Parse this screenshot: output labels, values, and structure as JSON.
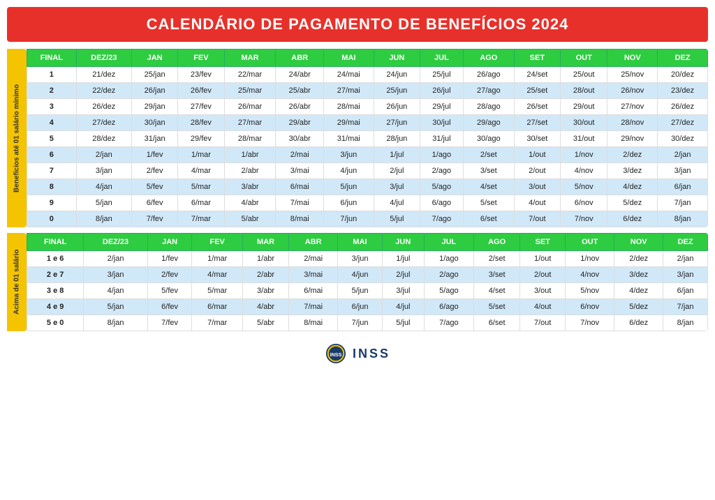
{
  "title": "CALENDÁRIO DE PAGAMENTO DE BENEFÍCIOS 2024",
  "table1": {
    "sideLabel": "Benefícios até 01 salário mínimo",
    "headers": [
      "FINAL",
      "DEZ/23",
      "JAN",
      "FEV",
      "MAR",
      "ABR",
      "MAI",
      "JUN",
      "JUL",
      "AGO",
      "SET",
      "OUT",
      "NOV",
      "DEZ"
    ],
    "rows": [
      [
        "1",
        "21/dez",
        "25/jan",
        "23/fev",
        "22/mar",
        "24/abr",
        "24/mai",
        "24/jun",
        "25/jul",
        "26/ago",
        "24/set",
        "25/out",
        "25/nov",
        "20/dez"
      ],
      [
        "2",
        "22/dez",
        "26/jan",
        "26/fev",
        "25/mar",
        "25/abr",
        "27/mai",
        "25/jun",
        "26/jul",
        "27/ago",
        "25/set",
        "28/out",
        "26/nov",
        "23/dez"
      ],
      [
        "3",
        "26/dez",
        "29/jan",
        "27/fev",
        "26/mar",
        "26/abr",
        "28/mai",
        "26/jun",
        "29/jul",
        "28/ago",
        "26/set",
        "29/out",
        "27/nov",
        "26/dez"
      ],
      [
        "4",
        "27/dez",
        "30/jan",
        "28/fev",
        "27/mar",
        "29/abr",
        "29/mai",
        "27/jun",
        "30/jul",
        "29/ago",
        "27/set",
        "30/out",
        "28/nov",
        "27/dez"
      ],
      [
        "5",
        "28/dez",
        "31/jan",
        "29/fev",
        "28/mar",
        "30/abr",
        "31/mai",
        "28/jun",
        "31/jul",
        "30/ago",
        "30/set",
        "31/out",
        "29/nov",
        "30/dez"
      ],
      [
        "6",
        "2/jan",
        "1/fev",
        "1/mar",
        "1/abr",
        "2/mai",
        "3/jun",
        "1/jul",
        "1/ago",
        "2/set",
        "1/out",
        "1/nov",
        "2/dez",
        "2/jan"
      ],
      [
        "7",
        "3/jan",
        "2/fev",
        "4/mar",
        "2/abr",
        "3/mai",
        "4/jun",
        "2/jul",
        "2/ago",
        "3/set",
        "2/out",
        "4/nov",
        "3/dez",
        "3/jan"
      ],
      [
        "8",
        "4/jan",
        "5/fev",
        "5/mar",
        "3/abr",
        "6/mai",
        "5/jun",
        "3/jul",
        "5/ago",
        "4/set",
        "3/out",
        "5/nov",
        "4/dez",
        "6/jan"
      ],
      [
        "9",
        "5/jan",
        "6/fev",
        "6/mar",
        "4/abr",
        "7/mai",
        "6/jun",
        "4/jul",
        "6/ago",
        "5/set",
        "4/out",
        "6/nov",
        "5/dez",
        "7/jan"
      ],
      [
        "0",
        "8/jan",
        "7/fev",
        "7/mar",
        "5/abr",
        "8/mai",
        "7/jun",
        "5/jul",
        "7/ago",
        "6/set",
        "7/out",
        "7/nov",
        "6/dez",
        "8/jan"
      ]
    ]
  },
  "table2": {
    "sideLabel": "Acima de 01 salário",
    "headers": [
      "FINAL",
      "DEZ/23",
      "JAN",
      "FEV",
      "MAR",
      "ABR",
      "MAI",
      "JUN",
      "JUL",
      "AGO",
      "SET",
      "OUT",
      "NOV",
      "DEZ"
    ],
    "rows": [
      [
        "1 e 6",
        "2/jan",
        "1/fev",
        "1/mar",
        "1/abr",
        "2/mai",
        "3/jun",
        "1/jul",
        "1/ago",
        "2/set",
        "1/out",
        "1/nov",
        "2/dez",
        "2/jan"
      ],
      [
        "2 e 7",
        "3/jan",
        "2/fev",
        "4/mar",
        "2/abr",
        "3/mai",
        "4/jun",
        "2/jul",
        "2/ago",
        "3/set",
        "2/out",
        "4/nov",
        "3/dez",
        "3/jan"
      ],
      [
        "3 e 8",
        "4/jan",
        "5/fev",
        "5/mar",
        "3/abr",
        "6/mai",
        "5/jun",
        "3/jul",
        "5/ago",
        "4/set",
        "3/out",
        "5/nov",
        "4/dez",
        "6/jan"
      ],
      [
        "4 e 9",
        "5/jan",
        "6/fev",
        "6/mar",
        "4/abr",
        "7/mai",
        "6/jun",
        "4/jul",
        "6/ago",
        "5/set",
        "4/out",
        "6/nov",
        "5/dez",
        "7/jan"
      ],
      [
        "5 e 0",
        "8/jan",
        "7/fev",
        "7/mar",
        "5/abr",
        "8/mai",
        "7/jun",
        "5/jul",
        "7/ago",
        "6/set",
        "7/out",
        "7/nov",
        "6/dez",
        "8/jan"
      ]
    ]
  },
  "footer": {
    "logoAlt": "INSS Logo",
    "logoText": "INSS"
  }
}
